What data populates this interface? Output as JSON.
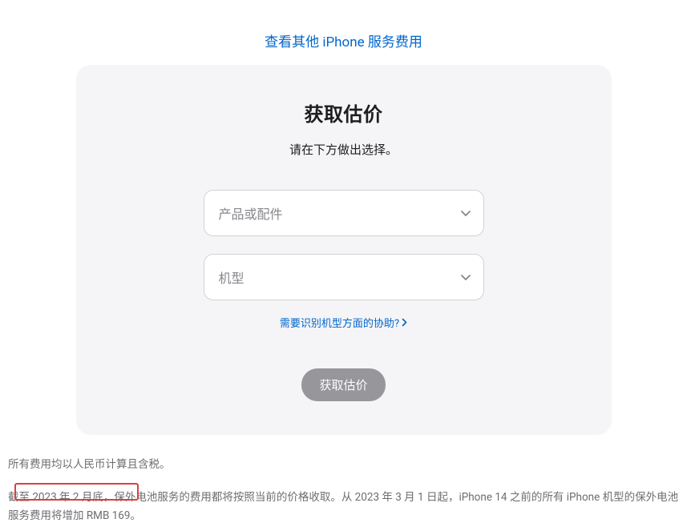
{
  "topLink": {
    "text": "查看其他 iPhone 服务费用"
  },
  "card": {
    "title": "获取估价",
    "subtitle": "请在下方做出选择。",
    "select1": {
      "placeholder": "产品或配件"
    },
    "select2": {
      "placeholder": "机型"
    },
    "helpLink": {
      "text": "需要识别机型方面的协助?"
    },
    "submit": {
      "label": "获取估价"
    }
  },
  "footnotes": {
    "note1": "所有费用均以人民币计算且含税。",
    "note2": "截至 2023 年 2 月底，保外电池服务的费用都将按照当前的价格收取。从 2023 年 3 月 1 日起，iPhone 14 之前的所有 iPhone 机型的保外电池服务费用将增加 RMB 169。"
  }
}
